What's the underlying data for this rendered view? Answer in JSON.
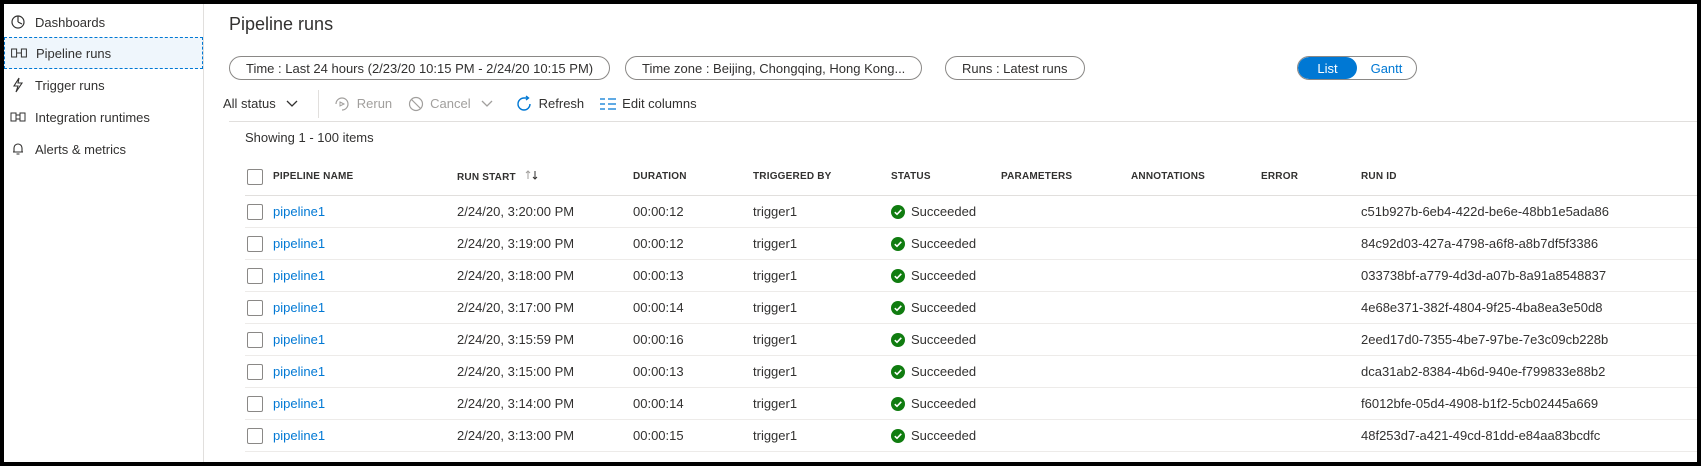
{
  "sidebar": {
    "items": [
      {
        "label": "Dashboards",
        "icon": "dashboard-icon"
      },
      {
        "label": "Pipeline runs",
        "icon": "pipeline-icon"
      },
      {
        "label": "Trigger runs",
        "icon": "trigger-icon"
      },
      {
        "label": "Integration runtimes",
        "icon": "integration-icon"
      },
      {
        "label": "Alerts & metrics",
        "icon": "bell-icon"
      }
    ]
  },
  "page": {
    "title": "Pipeline runs"
  },
  "filters": {
    "time": "Time : Last 24 hours (2/23/20 10:15 PM - 2/24/20 10:15 PM)",
    "timezone": "Time zone : Beijing, Chongqing, Hong Kong...",
    "runs": "Runs : Latest runs",
    "view_list": "List",
    "view_gantt": "Gantt"
  },
  "toolbar": {
    "status": "All status",
    "rerun": "Rerun",
    "cancel": "Cancel",
    "refresh": "Refresh",
    "edit_columns": "Edit columns"
  },
  "showing": "Showing 1 - 100 items",
  "table": {
    "headers": {
      "name": "PIPELINE NAME",
      "start": "RUN START",
      "duration": "DURATION",
      "triggered": "TRIGGERED BY",
      "status": "STATUS",
      "parameters": "PARAMETERS",
      "annotations": "ANNOTATIONS",
      "error": "ERROR",
      "runid": "RUN ID"
    },
    "rows": [
      {
        "name": "pipeline1",
        "start": "2/24/20, 3:20:00 PM",
        "duration": "00:00:12",
        "triggered": "trigger1",
        "status": "Succeeded",
        "runid": "c51b927b-6eb4-422d-be6e-48bb1e5ada86"
      },
      {
        "name": "pipeline1",
        "start": "2/24/20, 3:19:00 PM",
        "duration": "00:00:12",
        "triggered": "trigger1",
        "status": "Succeeded",
        "runid": "84c92d03-427a-4798-a6f8-a8b7df5f3386"
      },
      {
        "name": "pipeline1",
        "start": "2/24/20, 3:18:00 PM",
        "duration": "00:00:13",
        "triggered": "trigger1",
        "status": "Succeeded",
        "runid": "033738bf-a779-4d3d-a07b-8a91a8548837"
      },
      {
        "name": "pipeline1",
        "start": "2/24/20, 3:17:00 PM",
        "duration": "00:00:14",
        "triggered": "trigger1",
        "status": "Succeeded",
        "runid": "4e68e371-382f-4804-9f25-4ba8ea3e50d8"
      },
      {
        "name": "pipeline1",
        "start": "2/24/20, 3:15:59 PM",
        "duration": "00:00:16",
        "triggered": "trigger1",
        "status": "Succeeded",
        "runid": "2eed17d0-7355-4be7-97be-7e3c09cb228b"
      },
      {
        "name": "pipeline1",
        "start": "2/24/20, 3:15:00 PM",
        "duration": "00:00:13",
        "triggered": "trigger1",
        "status": "Succeeded",
        "runid": "dca31ab2-8384-4b6d-940e-f799833e88b2"
      },
      {
        "name": "pipeline1",
        "start": "2/24/20, 3:14:00 PM",
        "duration": "00:00:14",
        "triggered": "trigger1",
        "status": "Succeeded",
        "runid": "f6012bfe-05d4-4908-b1f2-5cb02445a669"
      },
      {
        "name": "pipeline1",
        "start": "2/24/20, 3:13:00 PM",
        "duration": "00:00:15",
        "triggered": "trigger1",
        "status": "Succeeded",
        "runid": "48f253d7-a421-49cd-81dd-e84aa83bcdfc"
      }
    ]
  },
  "colors": {
    "accent": "#0078d4",
    "success": "#107c10"
  }
}
